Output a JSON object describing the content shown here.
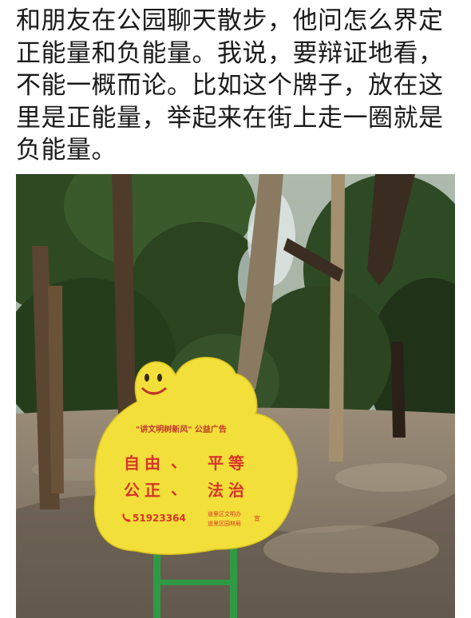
{
  "post": {
    "lines": [
      "和朋友在公园聊天散步，他问怎么界定",
      "正能量和负能量。我说，要辩证地看，",
      "不能一概而论。比如这个牌子，放在这",
      "里是正能量，举起来在街上走一圈就是",
      "负能量。"
    ]
  },
  "photo": {
    "sign": {
      "header": "\"讲文明树新风\" 公益广告",
      "line1_left": "自由",
      "line1_sep": "、",
      "line1_right": "平等",
      "line2_left": "公正",
      "line2_sep": "、",
      "line2_right": "法治",
      "phone": "51923364",
      "phone_icon": "phone-icon",
      "org_line1": "道里区文明办",
      "org_line2": "道里区园林局",
      "org_suffix": "宣"
    },
    "colors": {
      "sign_yellow": "#f2df3a",
      "sign_red": "#d8342a",
      "post_green": "#2f9a44"
    }
  }
}
